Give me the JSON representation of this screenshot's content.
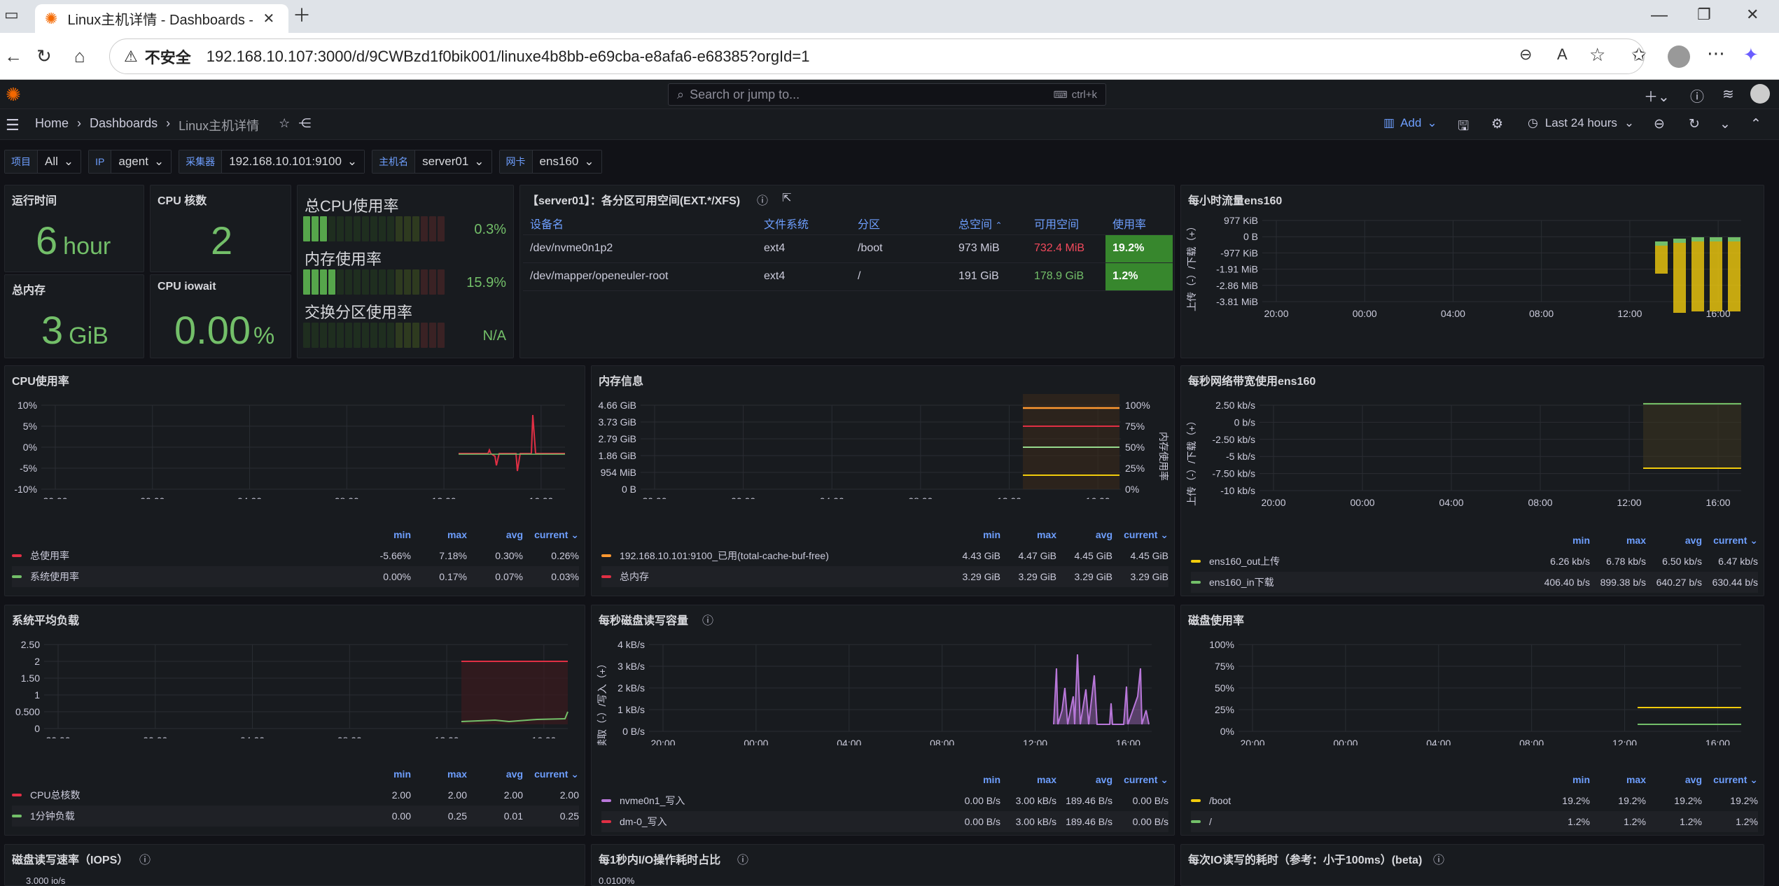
{
  "browser": {
    "tab_title": "Linux主机详情 - Dashboards - Gra",
    "insecure": "不安全",
    "url": "192.168.10.107:3000/d/9CWBzd1f0bik001/linuxe4b8bb-e69cba-e8afa6-e68385?orgId=1"
  },
  "grafana": {
    "search_placeholder": "Search or jump to...",
    "search_hint": "ctrl+k",
    "breadcrumb": [
      "Home",
      "Dashboards",
      "Linux主机详情"
    ],
    "add_label": "Add",
    "time_range": "Last 24 hours"
  },
  "variables": [
    {
      "label": "项目",
      "value": "All"
    },
    {
      "label": "IP",
      "value": "agent"
    },
    {
      "label": "采集器",
      "value": "192.168.10.101:9100"
    },
    {
      "label": "主机名",
      "value": "server01"
    },
    {
      "label": "网卡",
      "value": "ens160"
    }
  ],
  "stats": {
    "uptime": {
      "title": "运行时间",
      "value": "6",
      "unit": "hour"
    },
    "cpu_cores": {
      "title": "CPU 核数",
      "value": "2"
    },
    "total_mem": {
      "title": "总内存",
      "value": "3",
      "unit": "GiB"
    },
    "iowait": {
      "title": "CPU iowait",
      "value": "0.00",
      "unit": "%"
    }
  },
  "gauges": [
    {
      "title": "总CPU使用率",
      "value": "0.3%",
      "fraction": 0.003
    },
    {
      "title": "内存使用率",
      "value": "15.9%",
      "fraction": 0.159
    },
    {
      "title": "交换分区使用率",
      "value": "N/A",
      "fraction": 0
    }
  ],
  "partitions": {
    "title": "【server01】：各分区可用空间(EXT.*/XFS)",
    "headers": [
      "设备名",
      "文件系统",
      "分区",
      "总空间",
      "可用空间",
      "使用率"
    ],
    "rows": [
      [
        "/dev/nvme0n1p2",
        "ext4",
        "/boot",
        "973 MiB",
        "732.4 MiB",
        "19.2%"
      ],
      [
        "/dev/mapper/openeuler-root",
        "ext4",
        "/",
        "191 GiB",
        "178.9 GiB",
        "1.2%"
      ]
    ]
  },
  "panels": {
    "traffic_hourly": "每小时流量ens160",
    "cpu": "CPU使用率",
    "mem": "内存信息",
    "net_bw": "每秒网络带宽使用ens160",
    "load": "系统平均负载",
    "disk_rw": "每秒磁盘读写容量",
    "disk_usage": "磁盘使用率",
    "iops": "磁盘读写速率（IOPS）",
    "io_time": "每1秒内I/O操作耗时占比",
    "io_latency": "每次IO读写的耗时（参考：小于100ms）(beta)"
  },
  "legend_heads": [
    "min",
    "max",
    "avg",
    "current"
  ],
  "x_ticks": [
    "20:00",
    "00:00",
    "04:00",
    "08:00",
    "12:00",
    "16:00"
  ],
  "chart_data": [
    {
      "type": "bar",
      "title": "每小时流量ens160",
      "ylabel": "上传（-）/下载（+）",
      "y_ticks": [
        "977 KiB",
        "0 B",
        "-977 KiB",
        "-1.91 MiB",
        "-2.86 MiB",
        "-3.81 MiB"
      ]
    },
    {
      "type": "line",
      "title": "CPU使用率",
      "y_ticks": [
        "10%",
        "5%",
        "0%",
        "-5%",
        "-10%"
      ],
      "series": [
        {
          "name": "总使用率",
          "min": "-5.66%",
          "max": "7.18%",
          "avg": "0.30%",
          "current": "0.26%"
        },
        {
          "name": "系统使用率",
          "min": "0.00%",
          "max": "0.17%",
          "avg": "0.07%",
          "current": "0.03%"
        }
      ]
    },
    {
      "type": "line",
      "title": "内存信息",
      "y_ticks": [
        "4.66 GiB",
        "3.73 GiB",
        "2.79 GiB",
        "1.86 GiB",
        "954 MiB",
        "0 B"
      ],
      "y2_ticks": [
        "100%",
        "75%",
        "50%",
        "25%",
        "0%"
      ],
      "y2label": "内存使用率",
      "series": [
        {
          "name": "192.168.10.101:9100_已用(total-cache-buf-free)",
          "min": "4.43 GiB",
          "max": "4.47 GiB",
          "avg": "4.45 GiB",
          "current": "4.45 GiB"
        },
        {
          "name": "总内存",
          "min": "3.29 GiB",
          "max": "3.29 GiB",
          "avg": "3.29 GiB",
          "current": "3.29 GiB"
        }
      ]
    },
    {
      "type": "line",
      "title": "每秒网络带宽使用ens160",
      "ylabel": "上传（-）/下载（+）",
      "y_ticks": [
        "2.50 kb/s",
        "0 b/s",
        "-2.50 kb/s",
        "-5 kb/s",
        "-7.50 kb/s",
        "-10 kb/s"
      ],
      "series": [
        {
          "name": "ens160_out上传",
          "min": "6.26 kb/s",
          "max": "6.78 kb/s",
          "avg": "6.50 kb/s",
          "current": "6.47 kb/s"
        },
        {
          "name": "ens160_in下载",
          "min": "406.40 b/s",
          "max": "899.38 b/s",
          "avg": "640.27 b/s",
          "current": "630.44 b/s"
        }
      ]
    },
    {
      "type": "line",
      "title": "系统平均负载",
      "y_ticks": [
        "2.50",
        "2",
        "1.50",
        "1",
        "0.500",
        "0"
      ],
      "series": [
        {
          "name": "CPU总核数",
          "min": "2.00",
          "max": "2.00",
          "avg": "2.00",
          "current": "2.00"
        },
        {
          "name": "1分钟负载",
          "min": "0.00",
          "max": "0.25",
          "avg": "0.01",
          "current": "0.25"
        }
      ]
    },
    {
      "type": "line",
      "title": "每秒磁盘读写容量",
      "ylabel": "读取（-）/写入（+）",
      "y_ticks": [
        "4 kB/s",
        "3 kB/s",
        "2 kB/s",
        "1 kB/s",
        "0 B/s"
      ],
      "series": [
        {
          "name": "nvme0n1_写入",
          "min": "0.00 B/s",
          "max": "3.00 kB/s",
          "avg": "189.46 B/s",
          "current": "0.00 B/s"
        },
        {
          "name": "dm-0_写入",
          "min": "0.00 B/s",
          "max": "3.00 kB/s",
          "avg": "189.46 B/s",
          "current": "0.00 B/s"
        }
      ]
    },
    {
      "type": "line",
      "title": "磁盘使用率",
      "y_ticks": [
        "100%",
        "75%",
        "50%",
        "25%",
        "0%"
      ],
      "series": [
        {
          "name": "/boot",
          "min": "19.2%",
          "max": "19.2%",
          "avg": "19.2%",
          "current": "19.2%"
        },
        {
          "name": "/",
          "min": "1.2%",
          "max": "1.2%",
          "avg": "1.2%",
          "current": "1.2%"
        }
      ]
    }
  ],
  "bottom_partials": {
    "iops_tick": "3.000 io/s",
    "iotime_tick": "0.0100%"
  },
  "colors": {
    "green": "#73bf69",
    "red": "#e02f44",
    "yellow": "#f2cc0c",
    "orange": "#ff9830",
    "purple": "#b877d9",
    "accent": "#6e9fff"
  }
}
